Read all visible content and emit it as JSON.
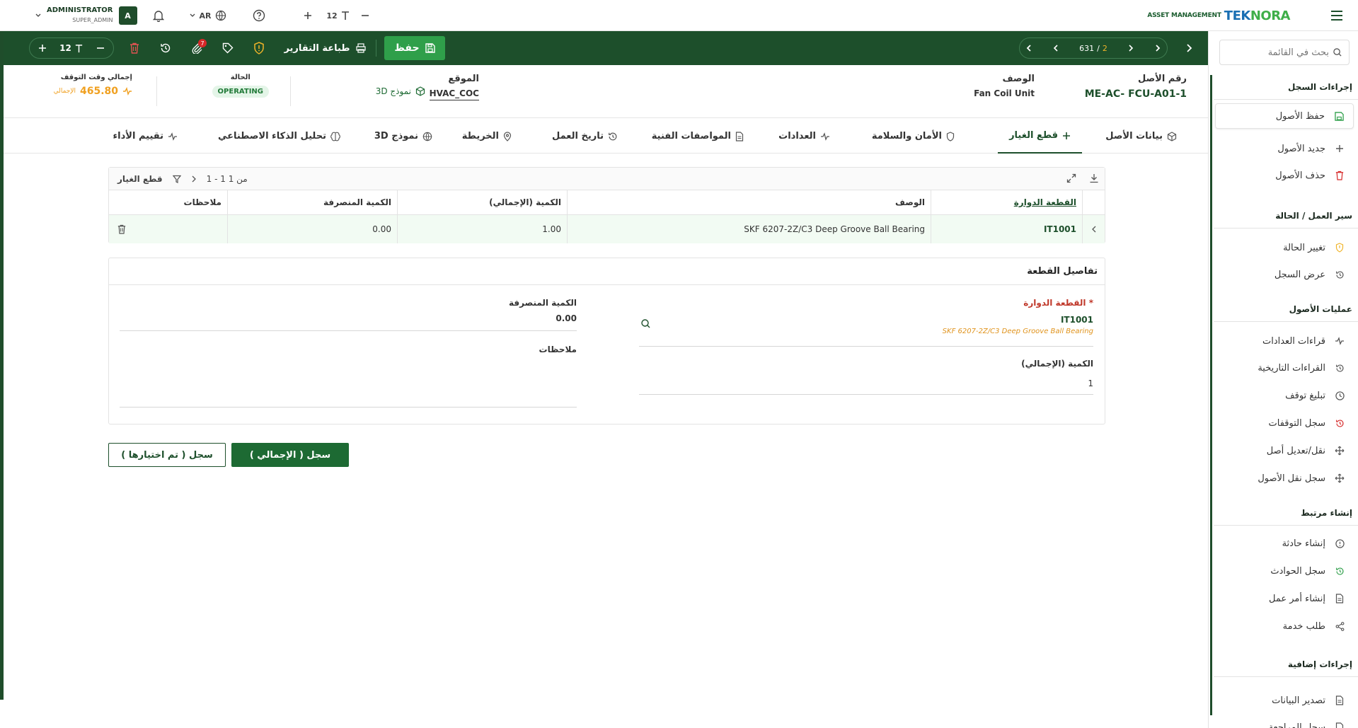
{
  "topbar": {
    "brand_prefix": "ASSET MANAGEMENT",
    "brand_name_a": "TEK",
    "brand_name_b": "NORA",
    "user_name": "ADMINISTRATOR",
    "user_role": "SUPER_ADMIN",
    "avatar_letter": "A",
    "language": "AR",
    "font_size": "12"
  },
  "toolbar": {
    "page_current": "2",
    "page_sep": "/",
    "page_total": "631",
    "save_label": "حفظ",
    "print_label": "طباعة التقارير",
    "attachments_count": "7",
    "font_size": "12"
  },
  "header": {
    "asset_no_label": "رقم الأصل",
    "asset_no_value": "ME-AC- FCU-A01-1",
    "desc_label": "الوصف",
    "desc_value": "Fan Coil Unit",
    "location_label": "الموقع",
    "location_value": "HVAC_COC",
    "model3d_label": "نموذج 3D",
    "status_label": "الحالة",
    "status_value": "OPERATING",
    "downtime_label": "إجمالي وقت التوقف",
    "downtime_value": "465.80",
    "downtime_sub": "الإجمالي"
  },
  "tabs": [
    {
      "label": "بيانات الأصل"
    },
    {
      "label": "قطع الغيار"
    },
    {
      "label": "الأمان والسلامة"
    },
    {
      "label": "العدادات"
    },
    {
      "label": "المواصفات الفنية"
    },
    {
      "label": "تاريخ العمل"
    },
    {
      "label": "الخريطة"
    },
    {
      "label": "نموذج 3D"
    },
    {
      "label": "تحليل الذكاء الاصطناعي"
    },
    {
      "label": "تقييم الأداء"
    }
  ],
  "grid": {
    "title": "قطع الغيار",
    "pagination": "1 - 1 من 1",
    "columns": [
      "القطعة الدوارة",
      "الوصف",
      "الكمية (الإجمالي)",
      "الكمية المنصرفة",
      "ملاحظات"
    ],
    "rows": [
      {
        "part": "IT1001",
        "desc": "SKF 6207-2Z/C3 Deep Groove Ball Bearing",
        "qty_total": "1.00",
        "qty_issued": "0.00",
        "notes": ""
      }
    ]
  },
  "details": {
    "title": "تفاصيل القطعة",
    "part_label": "* القطعة الدوارة",
    "part_value": "IT1001",
    "part_hint": "SKF 6207-2Z/C3 Deep Groove Ball Bearing",
    "qty_total_label": "الكمية (الإجمالي)",
    "qty_total_value": "1",
    "qty_issued_label": "الكمية المنصرفة",
    "qty_issued_value": "0.00",
    "notes_label": "ملاحظات"
  },
  "buttons": {
    "log_total": "سجل ( الإجمالي )",
    "log_selected": "سجل ( تم اختيارها )"
  },
  "sidebar": {
    "search_placeholder": "بحث في القائمة",
    "sections": [
      {
        "title": "إجراءات السجل",
        "items": [
          "حفظ الأصول",
          "جديد الأصول",
          "حذف الأصول"
        ]
      },
      {
        "title": "سير العمل / الحالة",
        "items": [
          "تغيير الحالة",
          "عرض السجل"
        ]
      },
      {
        "title": "عمليات الأصول",
        "items": [
          "قراءات العدادات",
          "القراءات التاريخية",
          "تبليغ توقف",
          "سجل التوقفات",
          "نقل/تعديل أصل",
          "سجل نقل الأصول"
        ]
      },
      {
        "title": "إنشاء مرتبط",
        "items": [
          "إنشاء حادثة",
          "سجل الحوادث",
          "إنشاء أمر عمل",
          "طلب خدمة"
        ]
      },
      {
        "title": "إجراءات إضافية",
        "items": [
          "تصدير البيانات",
          "سجل المراجعة"
        ]
      }
    ]
  },
  "colors": {
    "primary": "#1d4f2b",
    "save_green": "#2f9f4a",
    "accent_orange": "#f0a020",
    "danger": "#d62828"
  }
}
